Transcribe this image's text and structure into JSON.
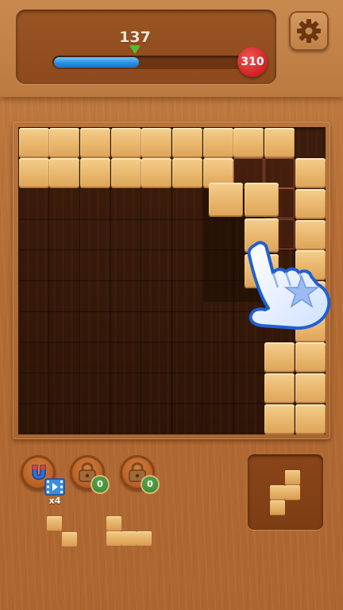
{
  "header": {
    "current_score": "137",
    "target_score": "310",
    "progress_fraction": 0.44,
    "progress_color": "#2b8fe0",
    "marker_color": "#4fbf34",
    "target_badge_color": "#cf2222"
  },
  "settings": {
    "icon": "gear-icon"
  },
  "board": {
    "rows": 10,
    "cols": 10,
    "filled_cells": [
      [
        0,
        0
      ],
      [
        0,
        1
      ],
      [
        0,
        2
      ],
      [
        0,
        3
      ],
      [
        0,
        4
      ],
      [
        0,
        5
      ],
      [
        0,
        6
      ],
      [
        0,
        7
      ],
      [
        0,
        8
      ],
      [
        1,
        0
      ],
      [
        1,
        1
      ],
      [
        1,
        2
      ],
      [
        1,
        3
      ],
      [
        1,
        4
      ],
      [
        1,
        5
      ],
      [
        1,
        6
      ],
      [
        1,
        9
      ],
      [
        2,
        9
      ],
      [
        3,
        9
      ],
      [
        4,
        9
      ],
      [
        5,
        9
      ],
      [
        6,
        9
      ],
      [
        7,
        9
      ],
      [
        8,
        9
      ],
      [
        9,
        9
      ],
      [
        7,
        8
      ],
      [
        8,
        8
      ],
      [
        9,
        8
      ]
    ],
    "highlighted_cells": [
      [
        1,
        7
      ],
      [
        1,
        8
      ],
      [
        2,
        8
      ],
      [
        3,
        8
      ]
    ],
    "block_color": "#e9b66c"
  },
  "tutorial": {
    "icon": "pointing-hand-icon"
  },
  "powerups": [
    {
      "name": "magnet",
      "icon": "magnet-icon",
      "count": ""
    },
    {
      "name": "locked-1",
      "icon": "lock-icon",
      "count": "0"
    },
    {
      "name": "locked-2",
      "icon": "lock-icon",
      "count": "0"
    }
  ],
  "video_reward": {
    "icon": "film-icon",
    "count": "x4"
  }
}
